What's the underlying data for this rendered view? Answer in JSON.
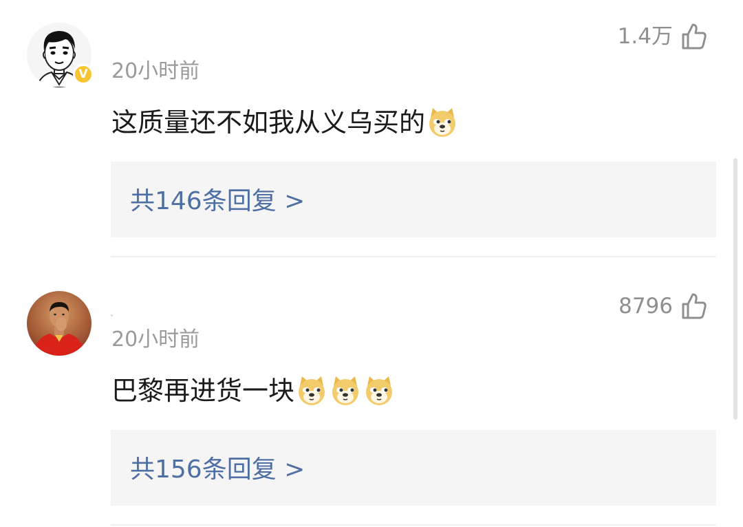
{
  "comments": [
    {
      "time": "20小时前",
      "likes": "1.4万",
      "text": "这质量还不如我从义乌买的",
      "emojis": [
        "doge"
      ],
      "verified_badge": "V",
      "replies_label": "共146条回复 >"
    },
    {
      "time": "20小时前",
      "likes": "8796",
      "text": "巴黎再进货一块",
      "emojis": [
        "doge",
        "doge",
        "doge"
      ],
      "replies_label": "共156条回复 >"
    }
  ],
  "colors": {
    "reply_link": "#4e6fa3",
    "reply_bg": "#f5f5f5",
    "muted_text": "#9a9a9a",
    "badge": "#f6c531"
  }
}
